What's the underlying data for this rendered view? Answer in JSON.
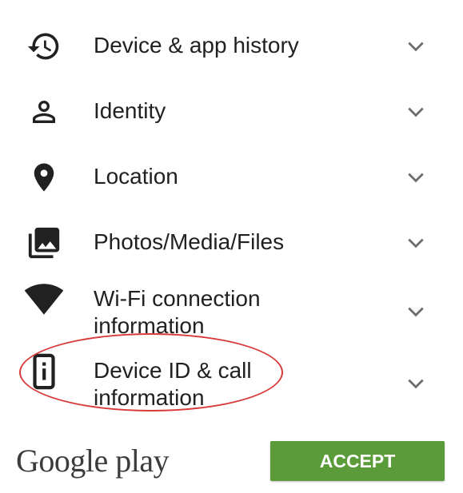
{
  "permissions": [
    {
      "label": "Device & app history",
      "icon": "history-icon"
    },
    {
      "label": "Identity",
      "icon": "person-icon"
    },
    {
      "label": "Location",
      "icon": "location-pin-icon"
    },
    {
      "label": "Photos/Media/Files",
      "icon": "photo-library-icon"
    },
    {
      "label": "Wi-Fi connection\ninformation",
      "icon": "wifi-icon"
    },
    {
      "label": "Device ID & call\ninformation",
      "icon": "device-info-icon"
    }
  ],
  "footer": {
    "logo_text": "Google play",
    "accept_label": "ACCEPT"
  },
  "colors": {
    "icon": "#212121",
    "chevron": "#6d6d6d",
    "accept_bg": "#5b9b3a",
    "highlight": "#d83a3a"
  }
}
